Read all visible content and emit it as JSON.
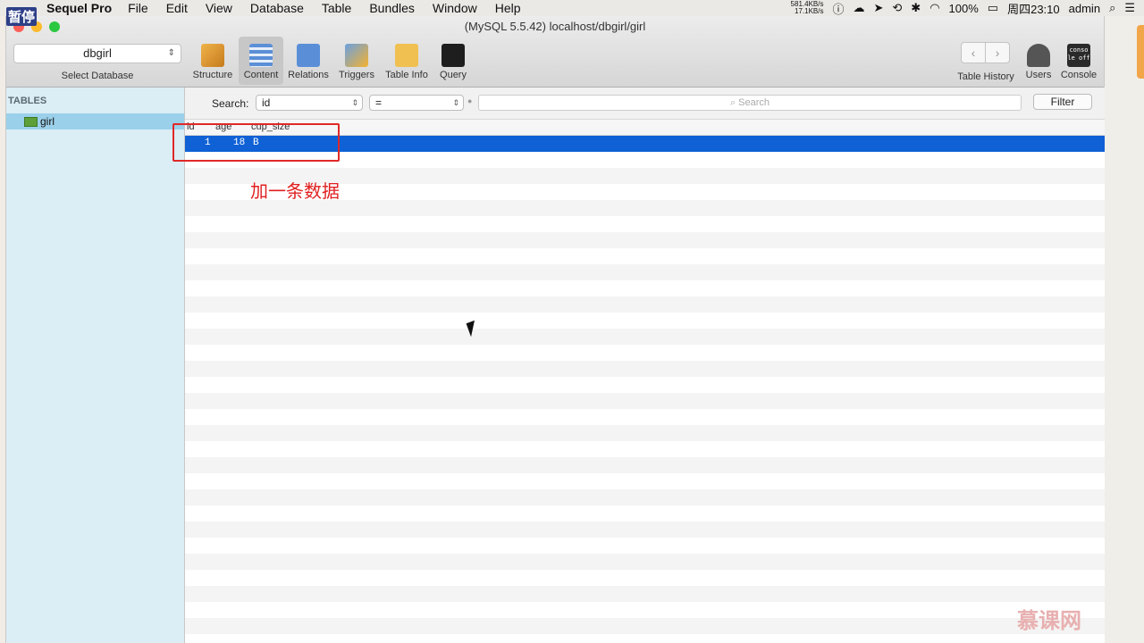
{
  "menubar": {
    "app_name": "Sequel Pro",
    "items": [
      "File",
      "Edit",
      "View",
      "Database",
      "Table",
      "Bundles",
      "Window",
      "Help"
    ],
    "net_up": "581.4KB/s",
    "net_down": "17.1KB/s",
    "battery": "100%",
    "clock": "周四23:10",
    "user": "admin"
  },
  "overlay": {
    "paused": "暂停"
  },
  "window": {
    "title": "(MySQL 5.5.42) localhost/dbgirl/girl",
    "database_select": "dbgirl",
    "database_label": "Select Database",
    "toolbar": [
      "Structure",
      "Content",
      "Relations",
      "Triggers",
      "Table Info",
      "Query"
    ],
    "toolbar_right": [
      "Table History",
      "Users",
      "Console"
    ],
    "console_icon_text": "conso le off"
  },
  "sidebar": {
    "header": "TABLES",
    "items": [
      "girl"
    ]
  },
  "searchbar": {
    "label": "Search:",
    "field": "id",
    "operator": "=",
    "placeholder": "Search",
    "filter_button": "Filter"
  },
  "grid": {
    "columns": [
      "id",
      "age",
      "cup_size"
    ],
    "rows": [
      [
        "1",
        "18",
        "B"
      ]
    ]
  },
  "annotation": {
    "text": "加一条数据"
  },
  "watermark": {
    "text": "慕课网"
  },
  "colors": {
    "selection": "#0f61d5",
    "sidebar_bg": "#dbedf5",
    "sidebar_selected": "#9bd0ea",
    "annotation": "#e02828"
  }
}
